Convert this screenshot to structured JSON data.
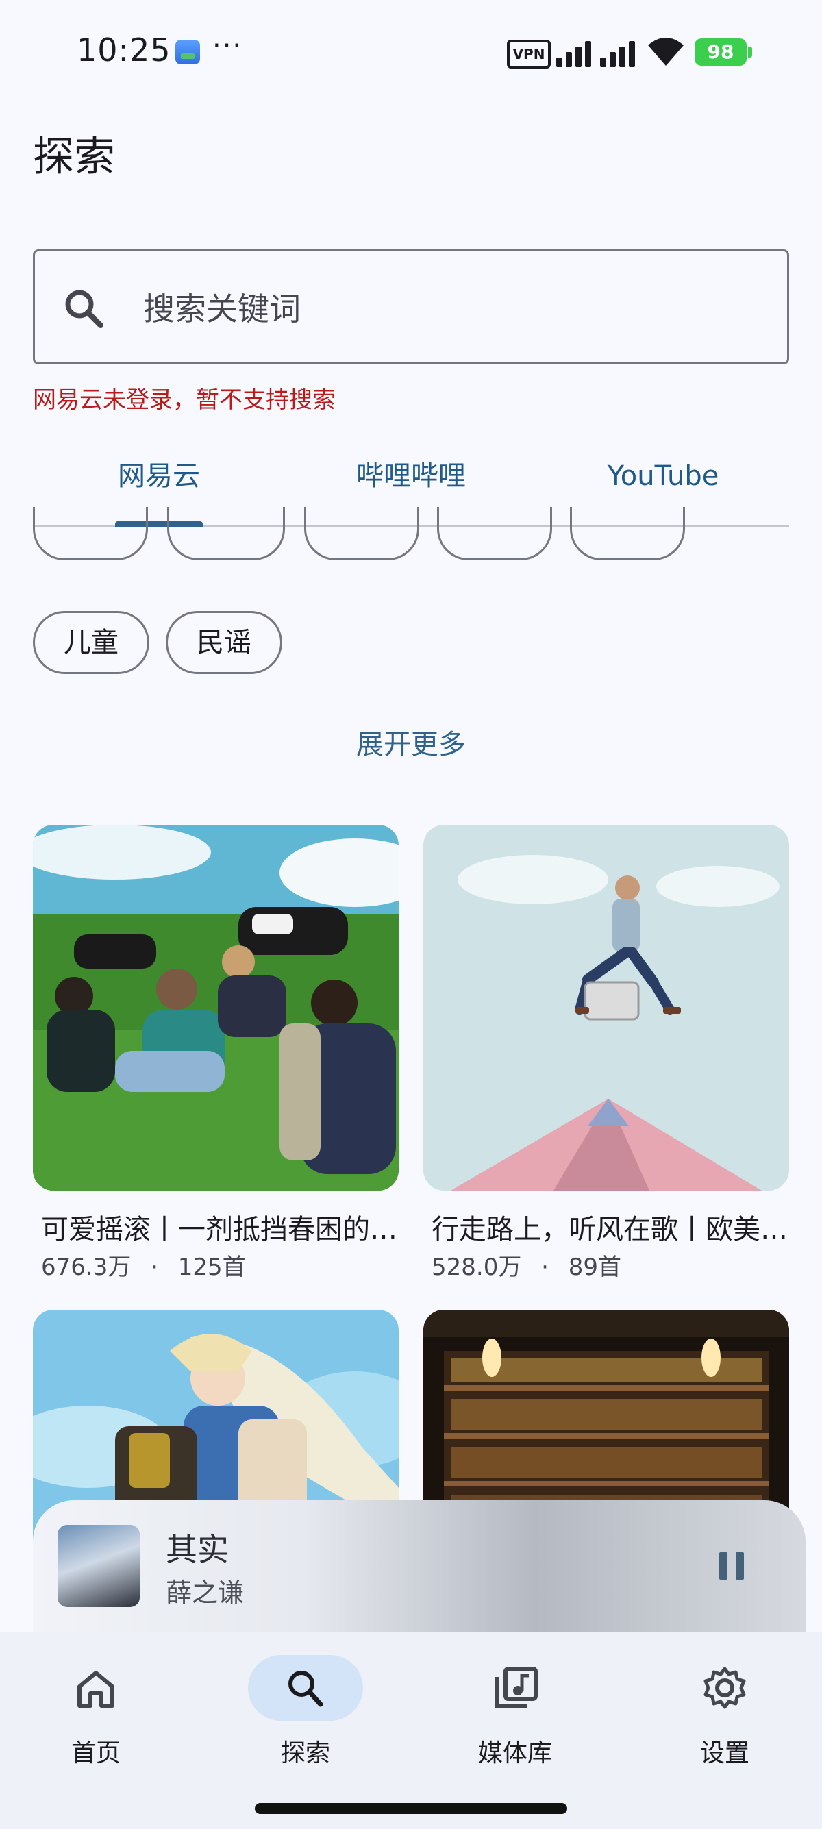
{
  "status_bar": {
    "time": "10:25",
    "more": "···",
    "vpn": "VPN",
    "battery": "98"
  },
  "header": {
    "title": "探索"
  },
  "search": {
    "placeholder": "搜索关键词",
    "error": "网易云未登录，暂不支持搜索"
  },
  "tabs": [
    {
      "label": "网易云",
      "active": true
    },
    {
      "label": "哔哩哔哩",
      "active": false
    },
    {
      "label": "YouTube",
      "active": false
    }
  ],
  "chips": [
    "儿童",
    "民谣"
  ],
  "expand_label": "展开更多",
  "playlists": [
    {
      "title": "可爱摇滚丨一剂抵挡春困的良药",
      "plays": "676.3万",
      "separator": "·",
      "tracks": "125首"
    },
    {
      "title": "行走路上，听风在歌丨欧美民谣",
      "plays": "528.0万",
      "separator": "·",
      "tracks": "89首"
    }
  ],
  "now_playing": {
    "title": "其实",
    "artist": "薛之谦"
  },
  "bottom_nav": [
    {
      "label": "首页",
      "icon": "home-icon",
      "active": false
    },
    {
      "label": "探索",
      "icon": "search-icon",
      "active": true
    },
    {
      "label": "媒体库",
      "icon": "library-music-icon",
      "active": false
    },
    {
      "label": "设置",
      "icon": "gear-icon",
      "active": false
    }
  ],
  "colors": {
    "accent": "#2f628c",
    "error": "#ba1a1a",
    "active_pill": "#d3e4f8",
    "background": "#f7f9ff"
  }
}
